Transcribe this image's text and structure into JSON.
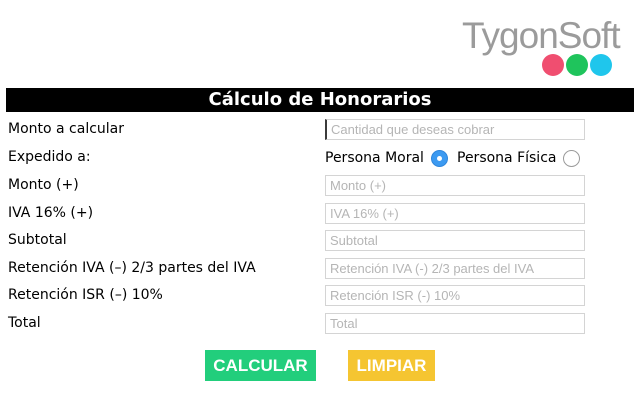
{
  "brand": {
    "name": "TygonSoft",
    "dot_colors": [
      "#f04e70",
      "#1fc45c",
      "#1fc6ec"
    ]
  },
  "title": "Cálculo de Honorarios",
  "form": {
    "monto_a_calcular": {
      "label": "Monto a calcular",
      "placeholder": "Cantidad que deseas cobrar"
    },
    "expedido": {
      "label": "Expedido a:",
      "options": [
        {
          "label": "Persona Moral",
          "selected": true
        },
        {
          "label": "Persona Física",
          "selected": false
        }
      ]
    },
    "monto": {
      "label": "Monto (+)",
      "placeholder": "Monto (+)"
    },
    "iva": {
      "label": "IVA 16% (+)",
      "placeholder": "IVA 16% (+)"
    },
    "subtotal": {
      "label": "Subtotal",
      "placeholder": "Subtotal"
    },
    "retencion_iva": {
      "label": "Retención IVA (–) 2/3 partes del IVA",
      "placeholder": "Retención IVA (-) 2/3 partes del IVA"
    },
    "retencion_isr": {
      "label": "Retención ISR (–) 10%",
      "placeholder": "Retención ISR (-) 10%"
    },
    "total": {
      "label": "Total",
      "placeholder": "Total"
    }
  },
  "buttons": {
    "calcular": {
      "label": "CALCULAR",
      "color": "#22ce7c"
    },
    "limpiar": {
      "label": "LIMPIAR",
      "color": "#f5c531"
    }
  },
  "colors": {
    "title_bar": "#000000",
    "radio_selected": "#3c9af1"
  }
}
